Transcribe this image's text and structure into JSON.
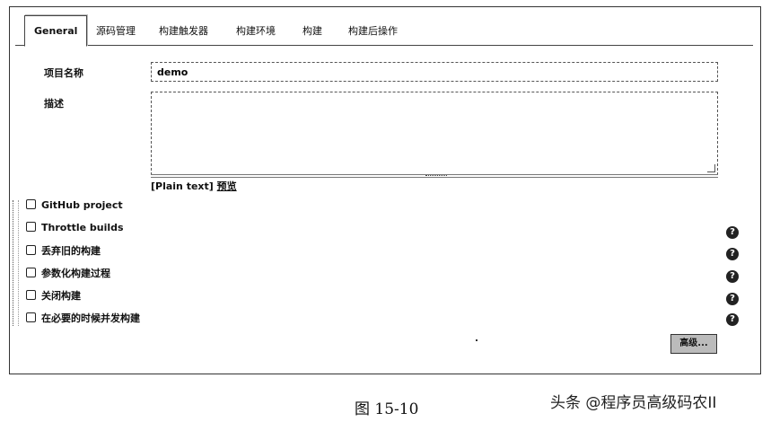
{
  "tabs": [
    {
      "label": "General"
    },
    {
      "label": "源码管理"
    },
    {
      "label": "构建触发器"
    },
    {
      "label": "构建环境"
    },
    {
      "label": "构建"
    },
    {
      "label": "构建后操作"
    }
  ],
  "form": {
    "project_name_label": "项目名称",
    "project_name_value": "demo",
    "description_label": "描述",
    "description_value": "",
    "plain_text": "[Plain text]",
    "preview_link": "预览"
  },
  "options": [
    {
      "label": "GitHub project",
      "checked": false,
      "help": false
    },
    {
      "label": "Throttle builds",
      "checked": false,
      "help": true
    },
    {
      "label": "丢弃旧的构建",
      "checked": false,
      "help": true
    },
    {
      "label": "参数化构建过程",
      "checked": false,
      "help": true
    },
    {
      "label": "关闭构建",
      "checked": false,
      "help": true
    },
    {
      "label": "在必要的时候并发构建",
      "checked": false,
      "help": true
    }
  ],
  "help_glyph": "?",
  "advanced_button": "高级...",
  "caption": "图 15-10",
  "watermark": "头条 @程序员高级码农II"
}
